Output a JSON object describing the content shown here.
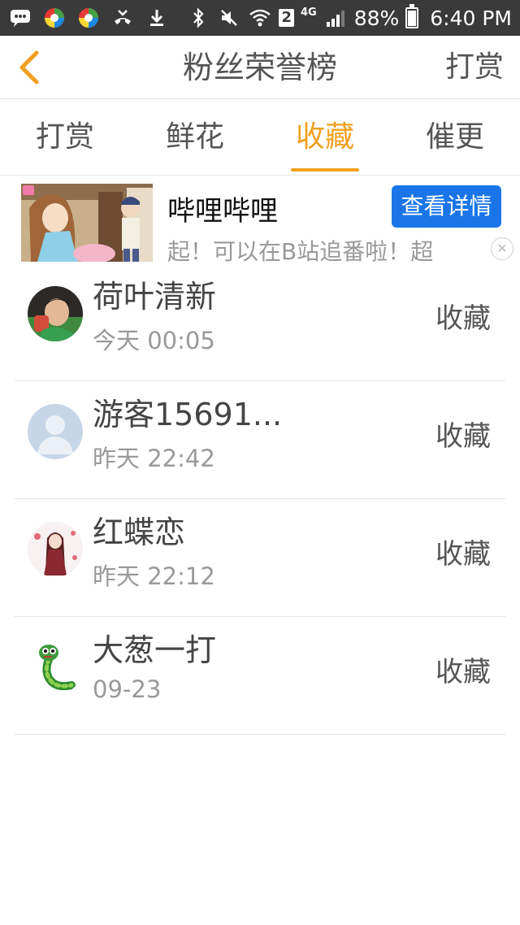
{
  "status_bar": {
    "battery": "88%",
    "time": "6:40 PM",
    "sim_badge": "2",
    "network": "4G"
  },
  "header": {
    "title": "粉丝荣誉榜",
    "action": "打赏"
  },
  "tabs": [
    {
      "label": "打赏",
      "active": false
    },
    {
      "label": "鲜花",
      "active": false
    },
    {
      "label": "收藏",
      "active": true
    },
    {
      "label": "催更",
      "active": false
    }
  ],
  "ad": {
    "title": "哔哩哔哩",
    "button": "查看详情",
    "description": "起！可以在B站追番啦！超"
  },
  "fans": [
    {
      "name": "荷叶清新",
      "time": "今天 00:05",
      "action": "收藏",
      "avatar": "boy-photo-avatar"
    },
    {
      "name": "游客15691...",
      "time": "昨天 22:42",
      "action": "收藏",
      "avatar": "default-avatar"
    },
    {
      "name": "红蝶恋",
      "time": "昨天 22:12",
      "action": "收藏",
      "avatar": "anime-girl-avatar"
    },
    {
      "name": "大葱一打",
      "time": "09-23",
      "action": "收藏",
      "avatar": "green-snake-avatar"
    }
  ],
  "colors": {
    "accent": "#f0a020",
    "status_bar": "#3a3a3a",
    "ad_button": "#1a76e8"
  }
}
